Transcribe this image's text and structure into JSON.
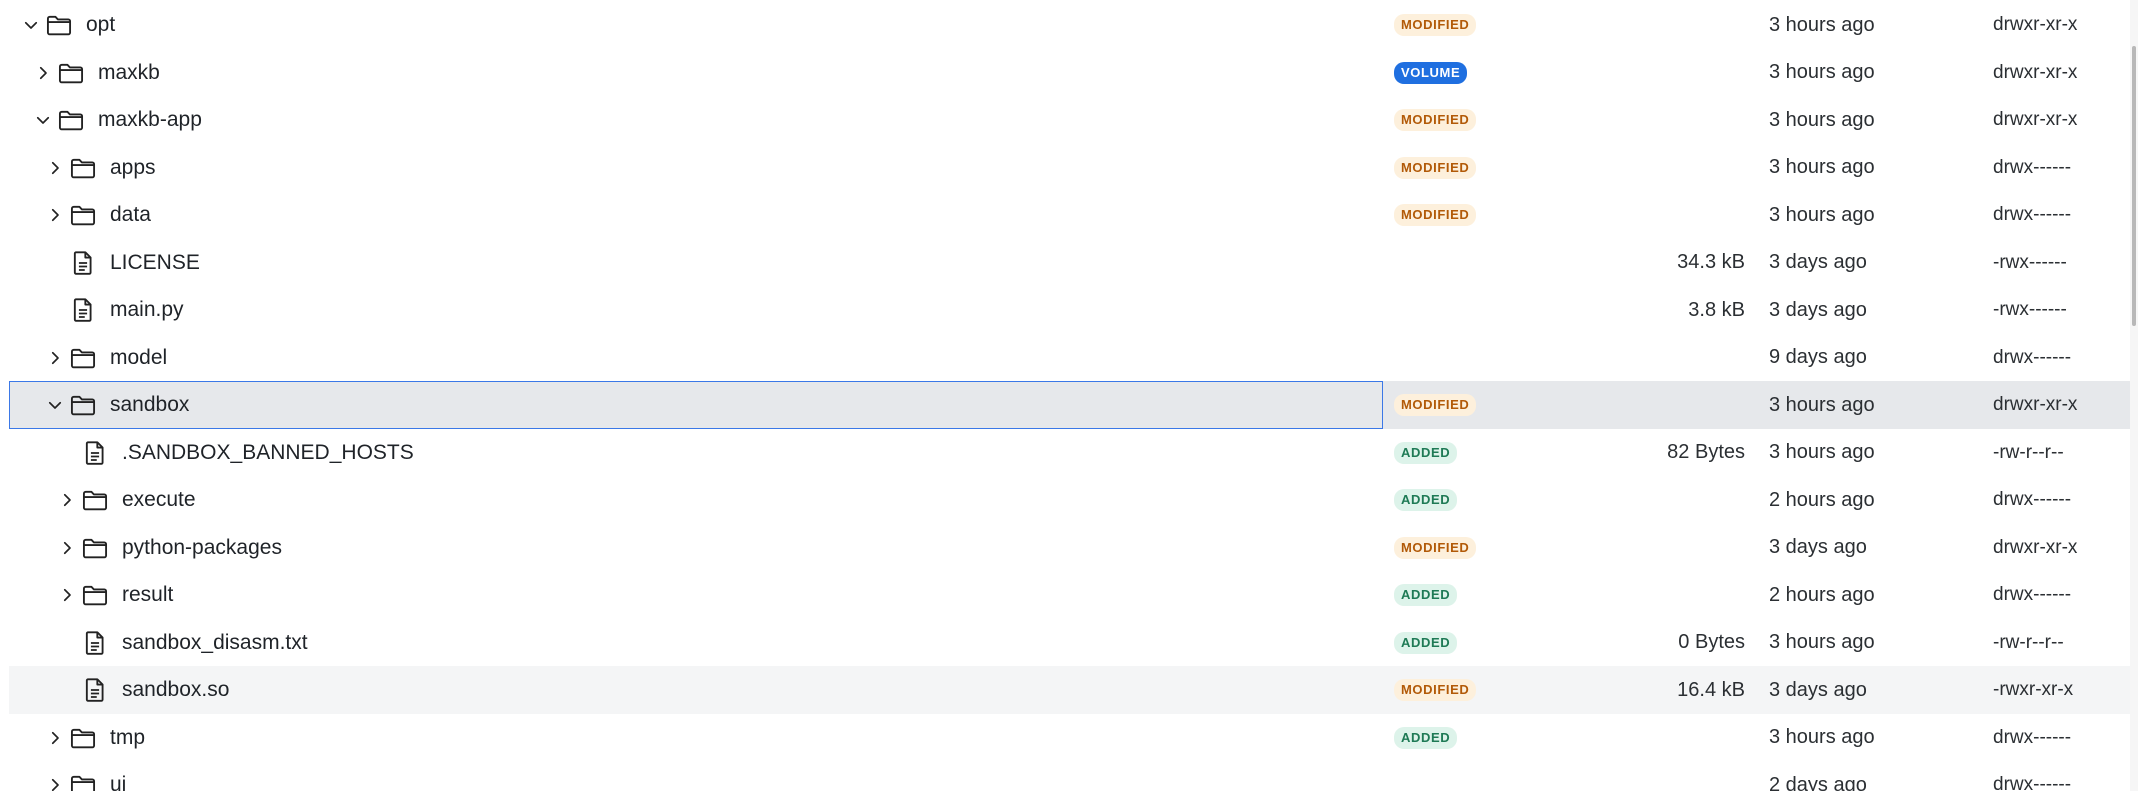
{
  "tree": {
    "rows": [
      {
        "name": "opt",
        "type": "folder",
        "expanded": true,
        "badge": "MODIFIED",
        "badge_kind": "modified",
        "size": "",
        "modified": "3 hours ago",
        "permissions": "drwxr-xr-x"
      },
      {
        "name": "maxkb",
        "type": "folder",
        "expanded": false,
        "badge": "VOLUME",
        "badge_kind": "volume",
        "size": "",
        "modified": "3 hours ago",
        "permissions": "drwxr-xr-x"
      },
      {
        "name": "maxkb-app",
        "type": "folder",
        "expanded": true,
        "badge": "MODIFIED",
        "badge_kind": "modified",
        "size": "",
        "modified": "3 hours ago",
        "permissions": "drwxr-xr-x"
      },
      {
        "name": "apps",
        "type": "folder",
        "expanded": false,
        "badge": "MODIFIED",
        "badge_kind": "modified",
        "size": "",
        "modified": "3 hours ago",
        "permissions": "drwx------"
      },
      {
        "name": "data",
        "type": "folder",
        "expanded": false,
        "badge": "MODIFIED",
        "badge_kind": "modified",
        "size": "",
        "modified": "3 hours ago",
        "permissions": "drwx------"
      },
      {
        "name": "LICENSE",
        "type": "file",
        "badge": "",
        "badge_kind": "",
        "size": "34.3 kB",
        "modified": "3 days ago",
        "permissions": "-rwx------"
      },
      {
        "name": "main.py",
        "type": "file",
        "badge": "",
        "badge_kind": "",
        "size": "3.8 kB",
        "modified": "3 days ago",
        "permissions": "-rwx------"
      },
      {
        "name": "model",
        "type": "folder",
        "expanded": false,
        "badge": "",
        "badge_kind": "",
        "size": "",
        "modified": "9 days ago",
        "permissions": "drwx------"
      },
      {
        "name": "sandbox",
        "type": "folder",
        "expanded": true,
        "badge": "MODIFIED",
        "badge_kind": "modified",
        "size": "",
        "modified": "3 hours ago",
        "permissions": "drwxr-xr-x",
        "state": "selected"
      },
      {
        "name": ".SANDBOX_BANNED_HOSTS",
        "type": "file",
        "badge": "ADDED",
        "badge_kind": "added",
        "size": "82 Bytes",
        "modified": "3 hours ago",
        "permissions": "-rw-r--r--"
      },
      {
        "name": "execute",
        "type": "folder",
        "expanded": false,
        "badge": "ADDED",
        "badge_kind": "added",
        "size": "",
        "modified": "2 hours ago",
        "permissions": "drwx------"
      },
      {
        "name": "python-packages",
        "type": "folder",
        "expanded": false,
        "badge": "MODIFIED",
        "badge_kind": "modified",
        "size": "",
        "modified": "3 days ago",
        "permissions": "drwxr-xr-x"
      },
      {
        "name": "result",
        "type": "folder",
        "expanded": false,
        "badge": "ADDED",
        "badge_kind": "added",
        "size": "",
        "modified": "2 hours ago",
        "permissions": "drwx------"
      },
      {
        "name": "sandbox_disasm.txt",
        "type": "file",
        "badge": "ADDED",
        "badge_kind": "added",
        "size": "0 Bytes",
        "modified": "3 hours ago",
        "permissions": "-rw-r--r--"
      },
      {
        "name": "sandbox.so",
        "type": "file",
        "badge": "MODIFIED",
        "badge_kind": "modified",
        "size": "16.4 kB",
        "modified": "3 days ago",
        "permissions": "-rwxr-xr-x",
        "state": "hover"
      },
      {
        "name": "tmp",
        "type": "folder",
        "expanded": false,
        "badge": "ADDED",
        "badge_kind": "added",
        "size": "",
        "modified": "3 hours ago",
        "permissions": "drwx------"
      },
      {
        "name": "ui",
        "type": "folder",
        "expanded": false,
        "badge": "",
        "badge_kind": "",
        "size": "",
        "modified": "2 days ago",
        "permissions": "drwx------"
      }
    ]
  },
  "colors": {
    "selected_background": "#e6e8eb",
    "selected_border": "#3b78e7",
    "hover_background": "#f4f5f6",
    "modified_badge": "#b25a08",
    "volume_badge": "#1f6fe0",
    "added_badge": "#1e7a55"
  }
}
